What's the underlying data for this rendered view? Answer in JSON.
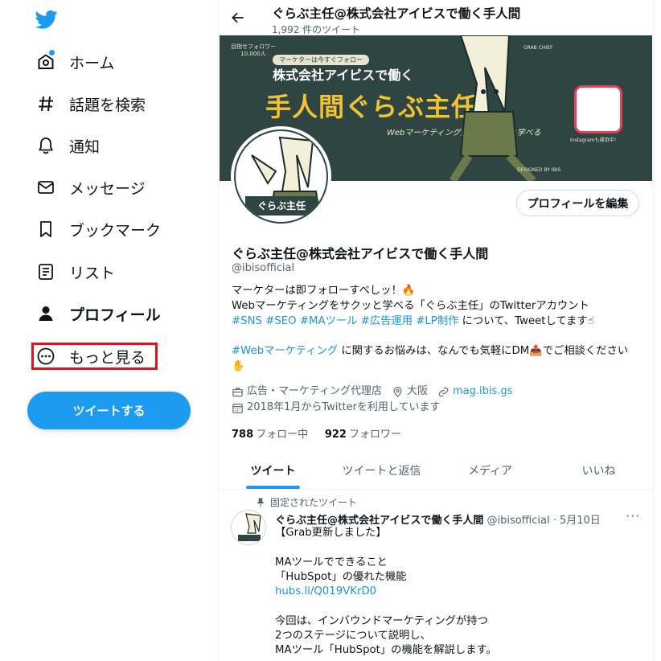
{
  "sidebar": {
    "items": [
      {
        "label": "ホーム",
        "icon": "home-icon"
      },
      {
        "label": "話題を検索",
        "icon": "hashtag-icon"
      },
      {
        "label": "通知",
        "icon": "bell-icon"
      },
      {
        "label": "メッセージ",
        "icon": "envelope-icon"
      },
      {
        "label": "ブックマーク",
        "icon": "bookmark-icon"
      },
      {
        "label": "リスト",
        "icon": "list-icon"
      },
      {
        "label": "プロフィール",
        "icon": "person-icon"
      },
      {
        "label": "もっと見る",
        "icon": "more-circle-icon"
      }
    ],
    "tweet_button": "ツイートする"
  },
  "header": {
    "title": "ぐらぶ主任@株式会社アイビスで働く手人間",
    "tweet_count": "1,992 件のツイート"
  },
  "banner": {
    "followers_note": "目指せフォロワー\n10,000人",
    "pill": "マーケターは今すぐフォロー",
    "line1": "株式会社アイビスで働く",
    "line2": "手人間ぐらぶ主任",
    "line3": "Webマーケティング知識をサクッと学べる",
    "grab_chief": "GRAB CHIEF",
    "designed_by": "DESIGNED BY IBIS",
    "instagram": "Instagramも運用中！"
  },
  "profile": {
    "avatar_badge": "ぐらぶ主任",
    "edit_button": "プロフィールを編集",
    "name": "ぐらぶ主任@株式会社アイビスで働く手人間",
    "handle": "@ibisofficial",
    "bio": {
      "line1": "マーケターは即フォローすべしッ！🔥",
      "line2": "Webマーケティングをサクッと学べる「ぐらぶ主任」のTwitterアカウント",
      "line3_tags": "#SNS #SEO #MAツール #広告運用 #LP制作",
      "line3_rest": " について、Tweetしてます☝",
      "line5_tag": "#Webマーケティング",
      "line5_rest": " に関するお悩みは、なんでも気軽にDM📤でご相談ください",
      "line6": "✋"
    },
    "category": "広告・マーケティング代理店",
    "location": "大阪",
    "url": "mag.ibis.gs",
    "joined": "2018年1月からTwitterを利用しています",
    "following_count": "788",
    "following_label": "フォロー中",
    "followers_count": "922",
    "followers_label": "フォロワー"
  },
  "tabs": [
    "ツイート",
    "ツイートと返信",
    "メディア",
    "いいね"
  ],
  "pinned_tweet": {
    "pinned_label": "固定されたツイート",
    "author": "ぐらぶ主任@株式会社アイビスで働く手人間",
    "meta": " @ibisofficial · 5月10日",
    "more": "···",
    "lines": [
      "【Grab更新しました】",
      "",
      "MAツールでできること",
      "「HubSpot」の優れた機能",
      "hubs.li/Q019VKrD0",
      "",
      "今回は、インバウンドマーケティングが持つ",
      "2つのステージについて説明し、",
      "MAツール「HubSpot」の機能を解説します。"
    ]
  },
  "colors": {
    "accent": "#1d9bf0",
    "highlight": "#e0141e",
    "banner_bg": "#2f4542",
    "banner_gold": "#f1c232"
  }
}
